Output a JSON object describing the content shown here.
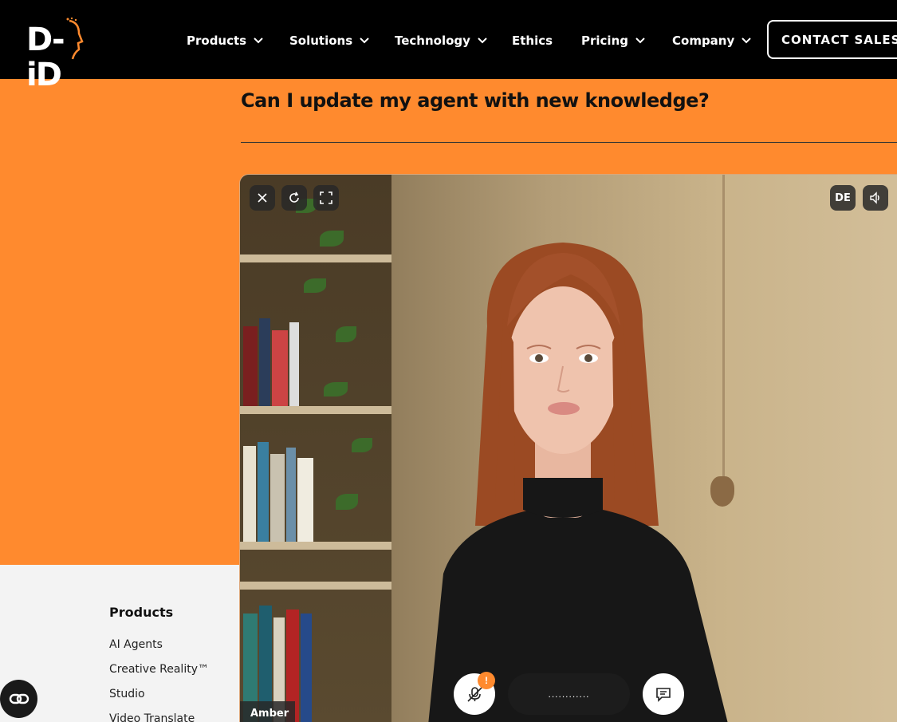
{
  "brand": {
    "logo_text": "D-iD"
  },
  "nav": {
    "items": [
      {
        "label": "Products",
        "has_dropdown": true
      },
      {
        "label": "Solutions",
        "has_dropdown": true
      },
      {
        "label": "Technology",
        "has_dropdown": true
      },
      {
        "label": "Ethics",
        "has_dropdown": false
      },
      {
        "label": "Pricing",
        "has_dropdown": true
      },
      {
        "label": "Company",
        "has_dropdown": true
      }
    ],
    "cta_label": "CONTACT SALES"
  },
  "faq": {
    "question": "Can I update my agent with new knowledge?"
  },
  "video": {
    "controls": {
      "close_icon": "close-icon",
      "refresh_icon": "refresh-icon",
      "fullscreen_icon": "fullscreen-icon",
      "language_label": "DE",
      "volume_icon": "speaker-icon"
    },
    "agent_name": "Amber",
    "mic_alert": "!",
    "waveform": "............"
  },
  "footer": {
    "heading": "Products",
    "links": [
      "AI Agents",
      "Creative Reality™",
      "Studio",
      "Video Translate"
    ]
  },
  "colors": {
    "accent": "#ff8a2e",
    "header_bg": "#000000",
    "footer_bg": "#f3f3f3"
  }
}
